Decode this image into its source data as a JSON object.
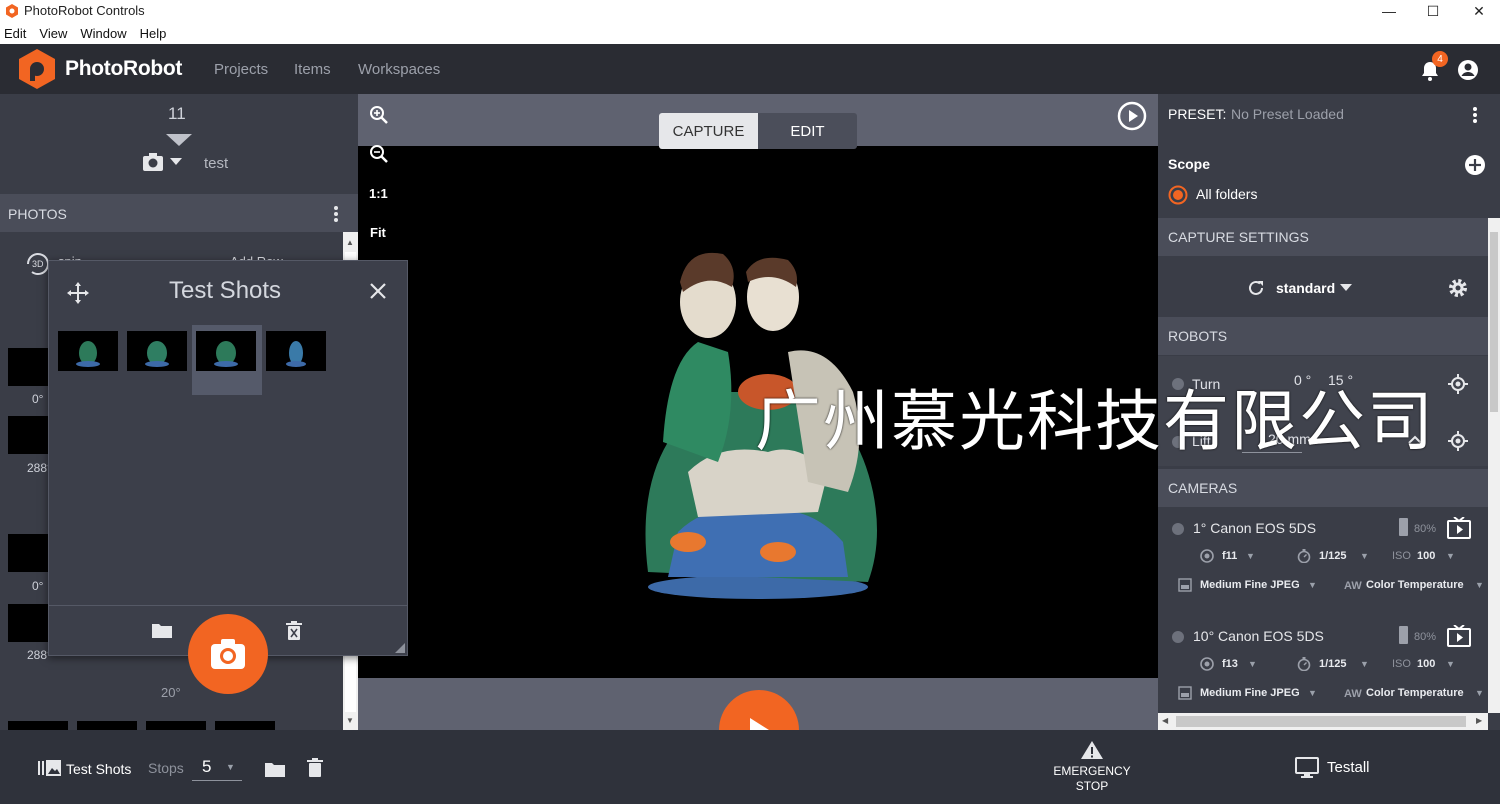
{
  "window": {
    "title": "PhotoRobot Controls",
    "minimize": "—",
    "maximize": "☐",
    "close": "✕"
  },
  "menu": [
    "Edit",
    "View",
    "Window",
    "Help"
  ],
  "nav": {
    "brand": "PhotoRobot",
    "links": [
      "Projects",
      "Items",
      "Workspaces"
    ],
    "notification_count": "4"
  },
  "left": {
    "counter": "11",
    "capture_name": "test",
    "photos_header": "PHOTOS",
    "spin_label": "spin",
    "add_row_label": "Add Row",
    "angles": [
      "0°",
      "288°",
      "0°",
      "288°"
    ],
    "degree_label": "20°"
  },
  "testshots": {
    "title": "Test Shots"
  },
  "viewer": {
    "tools": [
      "1:1",
      "Fit"
    ],
    "tabs": [
      "CAPTURE",
      "EDIT"
    ],
    "emergency": [
      "EMERGENCY",
      "STOP"
    ]
  },
  "right": {
    "preset_label": "PRESET:",
    "preset_value": "No Preset Loaded",
    "scope_label": "Scope",
    "scope_option": "All folders",
    "capture_settings": "CAPTURE SETTINGS",
    "capture_mode": "standard",
    "robots_header": "ROBOTS",
    "robots": [
      {
        "name": "Turn",
        "value": "0 °",
        "step": "15 °"
      },
      {
        "name": "Lift",
        "value": "20 mm"
      }
    ],
    "cameras_header": "CAMERAS",
    "cameras": [
      {
        "name": "1° Canon EOS 5DS",
        "battery": "80%",
        "aperture": "f11",
        "shutter": "1/125",
        "iso_label": "ISO",
        "iso": "100",
        "quality": "Medium Fine JPEG",
        "wb": "Color Temperature"
      },
      {
        "name": "10° Canon EOS 5DS",
        "battery": "80%",
        "aperture": "f13",
        "shutter": "1/125",
        "iso_label": "ISO",
        "iso": "100",
        "quality": "Medium Fine JPEG",
        "wb": "Color Temperature"
      }
    ]
  },
  "bottom": {
    "testshots_label": "Test Shots",
    "stops_label": "Stops",
    "stops_value": "5",
    "workstation": "Testall"
  },
  "watermark": "广州慕光科技有限公司",
  "colors": {
    "accent": "#f26522",
    "panel": "#3a3d47",
    "header": "#4a4d59",
    "nav": "#2a2c33"
  }
}
